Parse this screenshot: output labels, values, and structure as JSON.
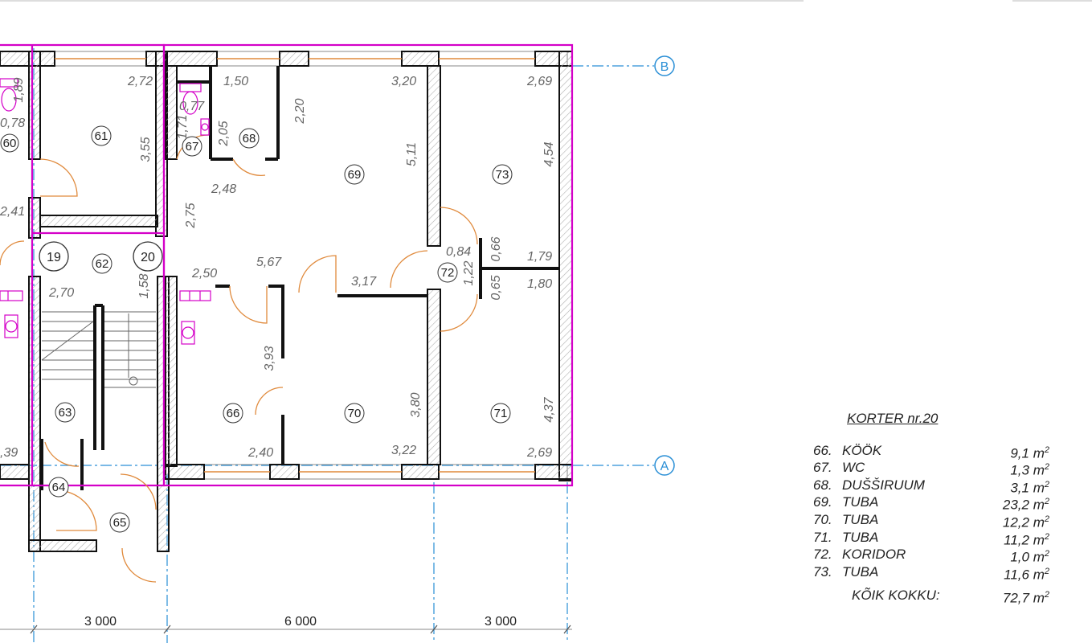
{
  "axes": {
    "b": "B",
    "a": "A"
  },
  "flats": {
    "left": "19",
    "right": "20"
  },
  "rooms": {
    "r60": "60",
    "r61": "61",
    "r62": "62",
    "r63": "63",
    "r64": "64",
    "r65": "65",
    "r66": "66",
    "r67": "67",
    "r68": "68",
    "r69": "69",
    "r70": "70",
    "r71": "71",
    "r72": "72",
    "r73": "73"
  },
  "dimensions": {
    "d272": "2,72",
    "d078": "0,78",
    "d355": "3,55",
    "d241": "2,41",
    "d039": ",39",
    "d270": "2,70",
    "d158": "1,58",
    "d150": "1,50",
    "d077": "0,77",
    "d205": "2,05",
    "d220": "2,20",
    "d320": "3,20",
    "d511": "5,11",
    "d248": "2,48",
    "d275": "2,75",
    "d269t": "2,69",
    "d454": "4,54",
    "d250": "2,50",
    "d567": "5,67",
    "d317": "3,17",
    "d084": "0,84",
    "d122": "1,22",
    "d066": "0,66",
    "d065": "0,65",
    "d179": "1,79",
    "d180": "1,80",
    "d393": "3,93",
    "d380": "3,80",
    "d437": "4,37",
    "d240": "2,40",
    "d322": "3,22",
    "d269b": "2,69",
    "d171": "1,71",
    "d189": "1,89"
  },
  "grid_spacing": {
    "s1": "3 000",
    "s2": "6 000",
    "s3": "3 000"
  },
  "legend": {
    "title": "KORTER nr.20",
    "unit": "m",
    "unit_sup": "2",
    "rows": [
      {
        "n": "66.",
        "name": "KÖÖK",
        "area": "9,1"
      },
      {
        "n": "67.",
        "name": "WC",
        "area": "1,3"
      },
      {
        "n": "68.",
        "name": "DUŠŠIRUUM",
        "area": "3,1"
      },
      {
        "n": "69.",
        "name": "TUBA",
        "area": "23,2"
      },
      {
        "n": "70.",
        "name": "TUBA",
        "area": "12,2"
      },
      {
        "n": "71.",
        "name": "TUBA",
        "area": "11,2"
      },
      {
        "n": "72.",
        "name": "KORIDOR",
        "area": "1,0"
      },
      {
        "n": "73.",
        "name": "TUBA",
        "area": "11,6"
      }
    ],
    "total_label": "KÕIK KOKKU:",
    "total_value": "72,7"
  },
  "colors": {
    "wall": "#111111",
    "hatch": "#b0b0b0",
    "boundary": "#d400c8",
    "axis": "#2a8fd6",
    "door": "#e08a3c"
  }
}
